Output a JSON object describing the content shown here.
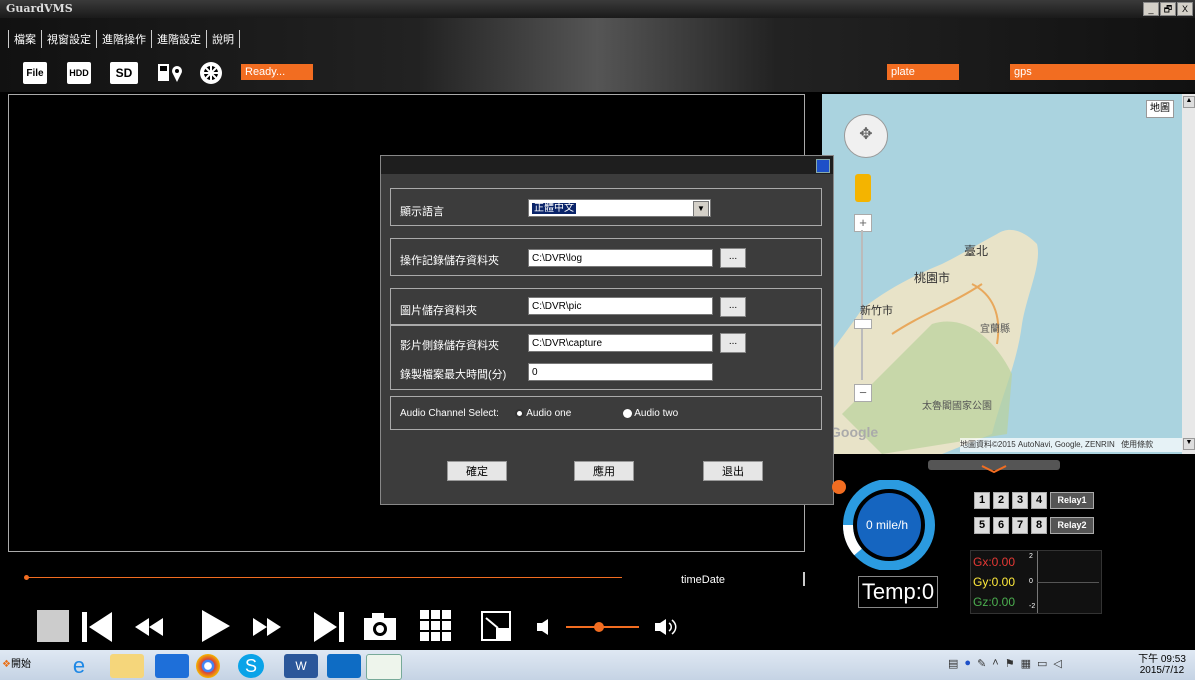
{
  "window": {
    "title": "GuardVMS",
    "controls": [
      "_",
      "🗗",
      "X"
    ]
  },
  "menu": [
    "檔案",
    "視窗設定",
    "進階操作",
    "進階設定",
    "說明"
  ],
  "toolbar": {
    "icons": [
      {
        "name": "file-icon",
        "text": "File"
      },
      {
        "name": "hdd-icon",
        "text": "HDD"
      },
      {
        "name": "sd-icon",
        "text": "SD"
      },
      {
        "name": "gps-file-icon",
        "text": ""
      },
      {
        "name": "wheel-icon",
        "text": ""
      }
    ],
    "status": "Ready...",
    "plate_label": "plate",
    "gps_label": "gps"
  },
  "map": {
    "type_button": "地圖",
    "labels": {
      "taipei": "臺北",
      "taoyuan": "桃園市",
      "hsinchu": "新竹市",
      "yilan": "宜蘭縣",
      "taroko": "太魯閣國家公園"
    },
    "attribution": "地圖資料©2015 AutoNavi, Google, ZENRIN",
    "terms": "使用條款",
    "google": "Google",
    "zoom_in": "+",
    "zoom_out": "−"
  },
  "dialog": {
    "language_label": "顯示語言",
    "language_value": "正體中文",
    "log_label": "操作記錄儲存資料夾",
    "log_path": "C:\\DVR\\log",
    "pic_label": "圖片儲存資料夾",
    "pic_path": "C:\\DVR\\pic",
    "video_label": "影片側錄儲存資料夾",
    "video_path": "C:\\DVR\\capture",
    "maxtime_label": "錄製檔案最大時間(分)",
    "maxtime_value": "0",
    "browse": "...",
    "audio_label": "Audio Channel Select:",
    "audio_one": "Audio one",
    "audio_two": "Audio two",
    "audio_selected": "Audio one",
    "ok": "確定",
    "apply": "應用",
    "exit": "退出"
  },
  "timeline": {
    "label": "timeDate"
  },
  "volume": {
    "level": 0.45
  },
  "speed": {
    "text": "0 mile/h"
  },
  "temp": {
    "text": "Temp:0"
  },
  "channels": [
    "1",
    "2",
    "3",
    "4",
    "5",
    "6",
    "7",
    "8"
  ],
  "relays": [
    "Relay1",
    "Relay2"
  ],
  "gsensor": {
    "gx": "Gx:0.00",
    "gy": "Gy:0.00",
    "gz": "Gz:0.00",
    "top": "2",
    "mid": "0",
    "bottom": "-2"
  },
  "taskbar": {
    "start": "開始",
    "time": "下午 09:53",
    "date": "2015/7/12"
  },
  "colors": {
    "accent": "#f26d21",
    "speed_blue": "#2b9be0",
    "gx": "#e53935",
    "gy": "#ffeb3b",
    "gz": "#4caf50"
  }
}
